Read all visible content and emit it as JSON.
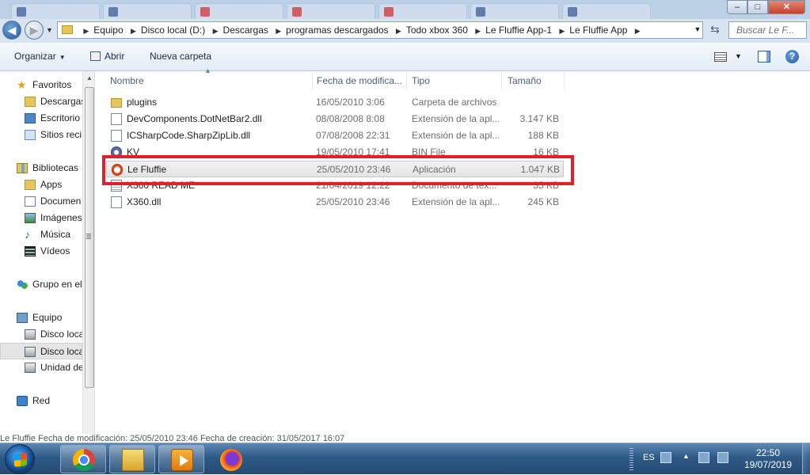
{
  "window": {
    "controls": {
      "minimize": "–",
      "maximize": "□",
      "close": "✕"
    }
  },
  "address": {
    "breadcrumbs": [
      "Equipo",
      "Disco local (D:)",
      "Descargas",
      "programas descargados",
      "Todo xbox 360",
      "Le Fluffie App-1",
      "Le Fluffie App"
    ],
    "search_placeholder": "Buscar Le F..."
  },
  "toolbar": {
    "organize_label": "Organizar",
    "open_label": "Abrir",
    "new_folder_label": "Nueva carpeta"
  },
  "navpane": {
    "favorites": {
      "label": "Favoritos",
      "items": [
        "Descargas",
        "Escritorio",
        "Sitios reci"
      ]
    },
    "libraries": {
      "label": "Bibliotecas",
      "items": [
        "Apps",
        "Documen",
        "Imágenes",
        "Música",
        "Vídeos"
      ]
    },
    "homegroup": {
      "label": "Grupo en el"
    },
    "computer": {
      "label": "Equipo",
      "items": [
        "Disco loca",
        "Disco loca",
        "Unidad de"
      ]
    },
    "network": {
      "label": "Red"
    }
  },
  "filelist": {
    "columns": {
      "name": "Nombre",
      "date": "Fecha de modifica...",
      "type": "Tipo",
      "size": "Tamaño"
    },
    "rows": [
      {
        "name": "plugins",
        "date": "16/05/2010 3:06",
        "type": "Carpeta de archivos",
        "size": "",
        "icon": "folder-icon"
      },
      {
        "name": "DevComponents.DotNetBar2.dll",
        "date": "08/08/2008 8:08",
        "type": "Extensión de la apl...",
        "size": "3.147 KB",
        "icon": "dll-file-icon"
      },
      {
        "name": "ICSharpCode.SharpZipLib.dll",
        "date": "07/08/2008 22:31",
        "type": "Extensión de la apl...",
        "size": "188 KB",
        "icon": "dll-file-icon"
      },
      {
        "name": "KV",
        "date": "19/05/2010 17:41",
        "type": "BIN File",
        "size": "16 KB",
        "icon": "bin-file-icon"
      },
      {
        "name": "Le Fluffie",
        "date": "25/05/2010 23:46",
        "type": "Aplicación",
        "size": "1.047 KB",
        "icon": "app-icon",
        "selected": true
      },
      {
        "name": "X360 READ ME",
        "date": "21/04/2019 12:22",
        "type": "Documento de tex...",
        "size": "35 KB",
        "icon": "text-file-icon"
      },
      {
        "name": "X360.dll",
        "date": "25/05/2010 23:46",
        "type": "Extensión de la apl...",
        "size": "245 KB",
        "icon": "dll-file-icon"
      }
    ],
    "highlight_color": "#e0202a"
  },
  "details": {
    "text": "Le Fluffie    Fecha de modificación: 25/05/2010 23:46         Fecha de creación: 31/05/2017 16:07"
  },
  "taskbar": {
    "apps": [
      "chrome",
      "explorer",
      "media-player",
      "firefox"
    ],
    "language": "ES",
    "time": "22:50",
    "date": "19/07/2019"
  },
  "colors": {
    "selection_row": "#e4e4e4",
    "taskbar": "#2e5a86",
    "highlight": "#e0202a"
  }
}
